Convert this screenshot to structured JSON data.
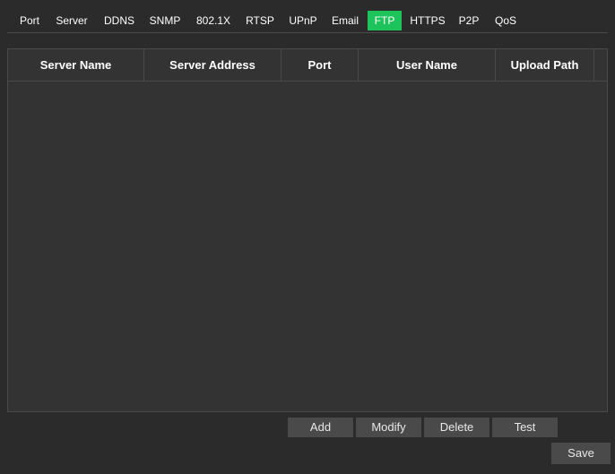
{
  "tabs": [
    {
      "label": "Port",
      "active": false
    },
    {
      "label": "Server",
      "active": false
    },
    {
      "label": "DDNS",
      "active": false
    },
    {
      "label": "SNMP",
      "active": false
    },
    {
      "label": "802.1X",
      "active": false
    },
    {
      "label": "RTSP",
      "active": false
    },
    {
      "label": "UPnP",
      "active": false
    },
    {
      "label": "Email",
      "active": false
    },
    {
      "label": "FTP",
      "active": true
    },
    {
      "label": "HTTPS",
      "active": false
    },
    {
      "label": "P2P",
      "active": false
    },
    {
      "label": "QoS",
      "active": false
    }
  ],
  "table": {
    "columns": [
      "Server Name",
      "Server Address",
      "Port",
      "User Name",
      "Upload Path"
    ],
    "rows": []
  },
  "actions": {
    "add": "Add",
    "modify": "Modify",
    "delete": "Delete",
    "test": "Test",
    "save": "Save"
  },
  "colors": {
    "background": "#2b2b2b",
    "accent": "#1dc35b",
    "button": "#4a4a4a"
  }
}
